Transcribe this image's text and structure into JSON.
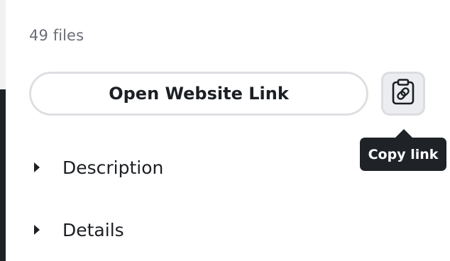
{
  "file_count": "49 files",
  "open_link_button": {
    "label": "Open Website Link"
  },
  "copy_button": {
    "icon": "clipboard-link-icon"
  },
  "tooltip": {
    "text": "Copy link"
  },
  "sections": [
    {
      "label": "Description",
      "icon": "caret-right-icon"
    },
    {
      "label": "Details",
      "icon": "caret-right-icon"
    }
  ],
  "colors": {
    "text_primary": "#1c1f23",
    "text_secondary": "#6b6f78",
    "border": "#dedfe3",
    "tooltip_bg": "#1f2328",
    "copy_button_bg": "#ecedf0"
  }
}
